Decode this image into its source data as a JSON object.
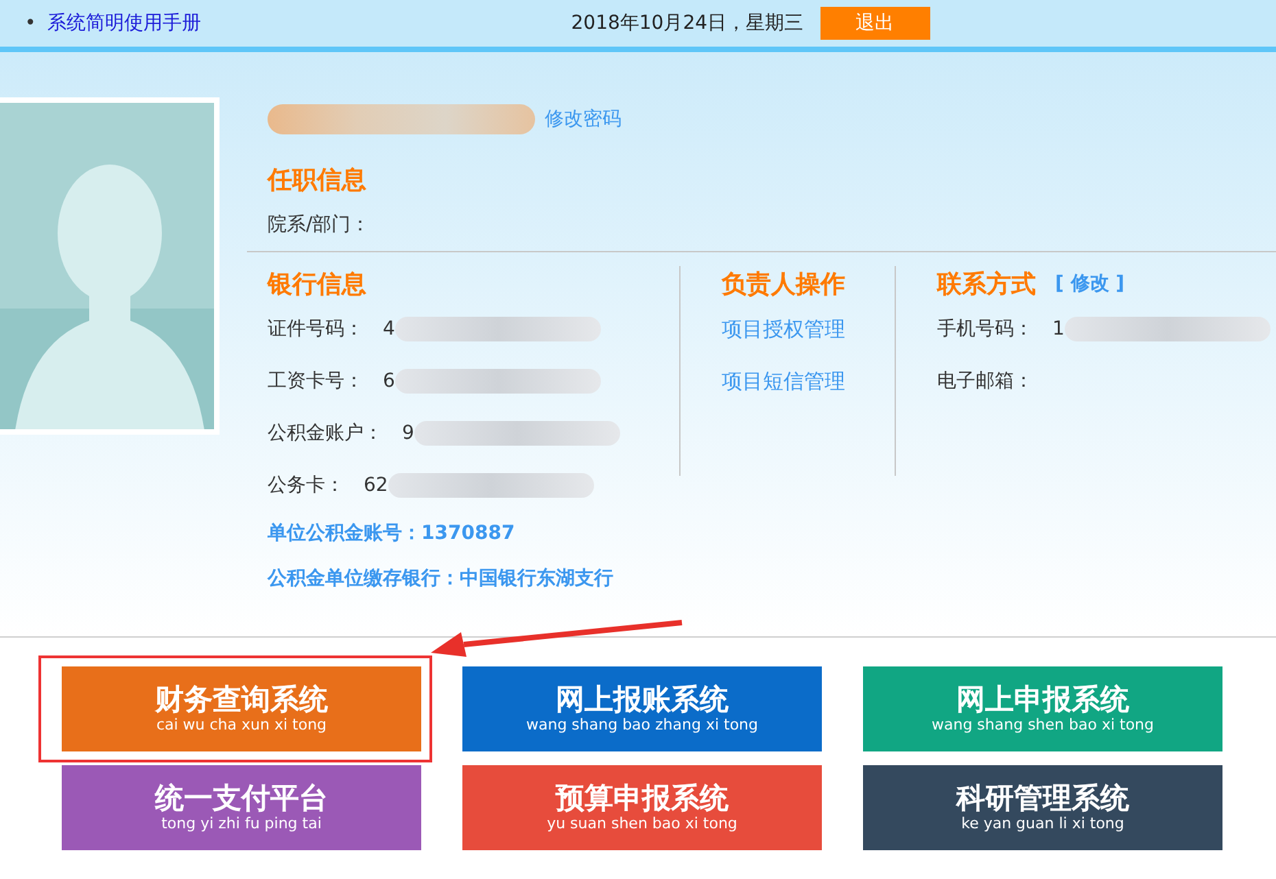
{
  "header": {
    "bullet": "•",
    "manual_link": "系统简明使用手册",
    "date": "2018年10月24日，星期三",
    "logout_button": "退出"
  },
  "profile": {
    "name": {
      "blurred": true
    },
    "change_password_link": "修改密码"
  },
  "employment": {
    "title": "任职信息",
    "fields": [
      {
        "label": "院系/部门："
      }
    ]
  },
  "bank": {
    "title": "银行信息",
    "fields": [
      {
        "label": "证件号码：",
        "value": "4",
        "blurred": true
      },
      {
        "label": "工资卡号：",
        "value": "6",
        "blurred": true
      },
      {
        "label": "公积金账户：",
        "value": "9",
        "blurred": true
      },
      {
        "label": "公务卡：",
        "value": "62",
        "blurred": true
      }
    ],
    "links": [
      "单位公积金账号：1370887",
      "公积金单位缴存银行：中国银行东湖支行"
    ]
  },
  "manager_ops": {
    "title": "负责人操作",
    "links": [
      "项目授权管理",
      "项目短信管理"
    ]
  },
  "contact": {
    "title": "联系方式",
    "edit_link": "[ 修改 ]",
    "fields": [
      {
        "label": "手机号码：",
        "value": "1",
        "blurred": true
      },
      {
        "label": "电子邮箱："
      }
    ]
  },
  "systems": [
    {
      "title": "财务查询系统",
      "pinyin": "cai wu cha xun xi tong",
      "color": "#e86f1a",
      "highlighted": true
    },
    {
      "title": "网上报账系统",
      "pinyin": "wang shang bao zhang xi tong",
      "color": "#0b6cc9",
      "highlighted": false
    },
    {
      "title": "网上申报系统",
      "pinyin": "wang shang shen bao xi tong",
      "color": "#11a683",
      "highlighted": false
    },
    {
      "title": "统一支付平台",
      "pinyin": "tong yi zhi fu ping tai",
      "color": "#9b59b6",
      "highlighted": false
    },
    {
      "title": "预算申报系统",
      "pinyin": "yu suan shen bao xi tong",
      "color": "#e74c3c",
      "highlighted": false
    },
    {
      "title": "科研管理系统",
      "pinyin": "ke yan guan li xi tong",
      "color": "#34495e",
      "highlighted": false
    }
  ]
}
